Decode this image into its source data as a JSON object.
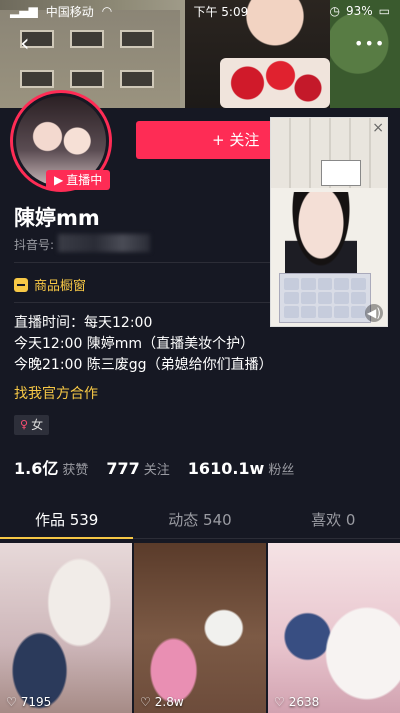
{
  "status_bar": {
    "carrier": "中国移动",
    "time": "下午 5:09",
    "battery": "93%"
  },
  "profile": {
    "live_badge": "直播中",
    "follow_label": "+ 关注",
    "name": "陳婷mm",
    "douyin_id_label": "抖音号:",
    "shop_label": "商品橱窗",
    "bio_lines": [
      "直播时间：每天12:00",
      "今天12:00 陳婷mm（直播美妆个护）",
      "今晚21:00 陈三废gg（弟媳给你们直播）"
    ],
    "bio_link": "找我官方合作",
    "gender": "女"
  },
  "stats": [
    {
      "num": "1.6亿",
      "label": "获赞"
    },
    {
      "num": "777",
      "label": "关注"
    },
    {
      "num": "1610.1w",
      "label": "粉丝"
    }
  ],
  "tabs": [
    {
      "label": "作品 539",
      "active": true
    },
    {
      "label": "动态 540",
      "active": false
    },
    {
      "label": "喜欢 0",
      "active": false
    }
  ],
  "videos": [
    {
      "likes": "7195"
    },
    {
      "likes": "2.8w"
    },
    {
      "likes": "2638"
    }
  ],
  "colors": {
    "accent": "#fe2c55",
    "highlight": "#f7c846",
    "background": "#161823"
  }
}
